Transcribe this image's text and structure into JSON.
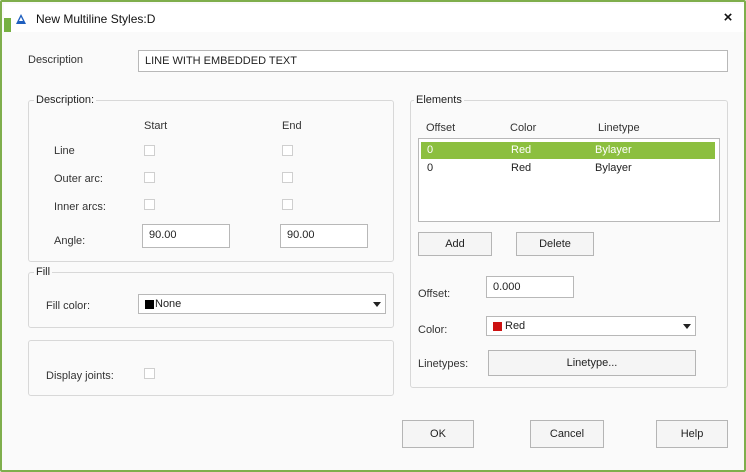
{
  "window": {
    "title": "New Multiline Styles:D",
    "close_glyph": "×"
  },
  "description": {
    "label": "Description",
    "value": "LINE WITH EMBEDDED TEXT"
  },
  "caps": {
    "legend": "Description:",
    "start_header": "Start",
    "end_header": "End",
    "rows": [
      {
        "label": "Line",
        "start_checked": false,
        "end_checked": false
      },
      {
        "label": "Outer arc:",
        "start_checked": false,
        "end_checked": false
      },
      {
        "label": "Inner arcs:",
        "start_checked": false,
        "end_checked": false
      }
    ],
    "angle_label": "Angle:",
    "angle_start": "90.00",
    "angle_end": "90.00"
  },
  "fill": {
    "legend": "Fill",
    "color_label": "Fill color:",
    "color_value": "None",
    "swatch_color": "#000000"
  },
  "joints": {
    "label": "Display joints:",
    "checked": false
  },
  "elements": {
    "legend": "Elements",
    "columns": [
      "Offset",
      "Color",
      "Linetype"
    ],
    "rows": [
      {
        "offset": "0",
        "color": "Red",
        "linetype": "Bylayer",
        "selected": true
      },
      {
        "offset": "0",
        "color": "Red",
        "linetype": "Bylayer",
        "selected": false
      }
    ],
    "add_label": "Add",
    "delete_label": "Delete",
    "offset_label": "Offset:",
    "offset_value": "0.000",
    "color_label": "Color:",
    "color_value": "Red",
    "color_swatch": "#cc1111",
    "linetypes_label": "Linetypes:",
    "linetype_button": "Linetype..."
  },
  "footer": {
    "ok_label": "OK",
    "cancel_label": "Cancel",
    "help_label": "Help"
  },
  "colors": {
    "accent": "#8cbf3f",
    "frame": "#7fae4c"
  }
}
